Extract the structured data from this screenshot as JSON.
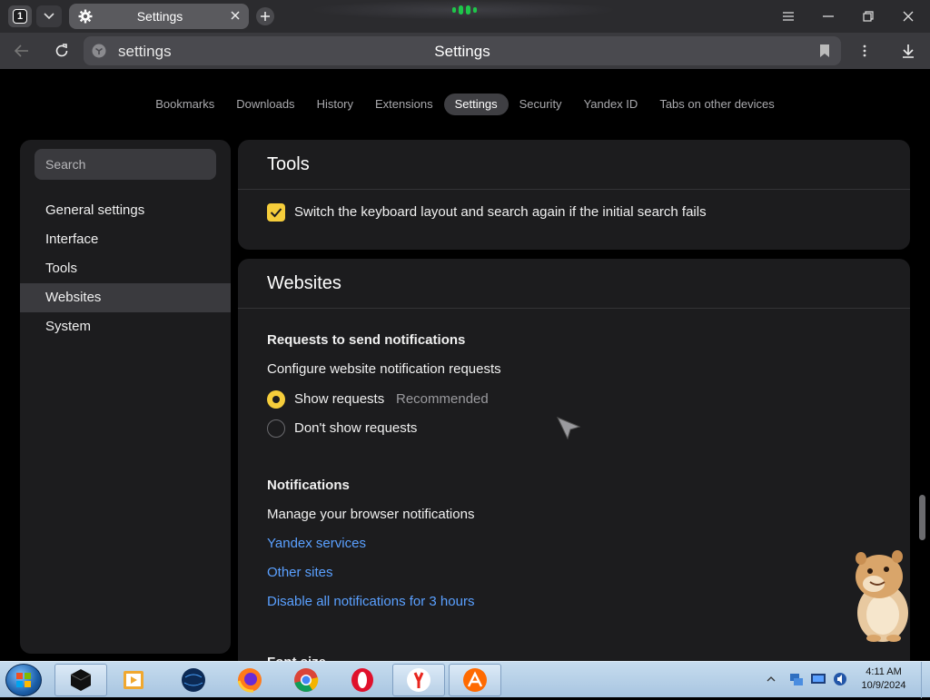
{
  "browser": {
    "tab_count": "1",
    "tab_title": "Settings",
    "address_url": "settings",
    "page_title": "Settings"
  },
  "topnav": {
    "items": [
      "Bookmarks",
      "Downloads",
      "History",
      "Extensions",
      "Settings",
      "Security",
      "Yandex ID",
      "Tabs on other devices"
    ],
    "active": "Settings"
  },
  "sidebar": {
    "search_placeholder": "Search",
    "items": [
      "General settings",
      "Interface",
      "Tools",
      "Websites",
      "System"
    ],
    "active": "Websites"
  },
  "tools_section": {
    "title": "Tools",
    "checkbox_label": "Switch the keyboard layout and search again if the initial search fails",
    "checkbox_checked": true
  },
  "websites_section": {
    "title": "Websites",
    "requests_heading": "Requests to send notifications",
    "requests_desc": "Configure website notification requests",
    "radio_show": "Show requests",
    "radio_show_tag": "Recommended",
    "radio_dont_show": "Don't show requests",
    "selected": "Show requests",
    "notifications_heading": "Notifications",
    "notifications_desc": "Manage your browser notifications",
    "link_yandex": "Yandex services",
    "link_other": "Other sites",
    "link_disable": "Disable all notifications for 3 hours",
    "font_size_heading": "Font size"
  },
  "taskbar": {
    "time": "4:11 AM",
    "date": "10/9/2024"
  },
  "colors": {
    "accent": "#f5cd3b",
    "link": "#5aa0ff",
    "panel": "#1c1c1e"
  }
}
